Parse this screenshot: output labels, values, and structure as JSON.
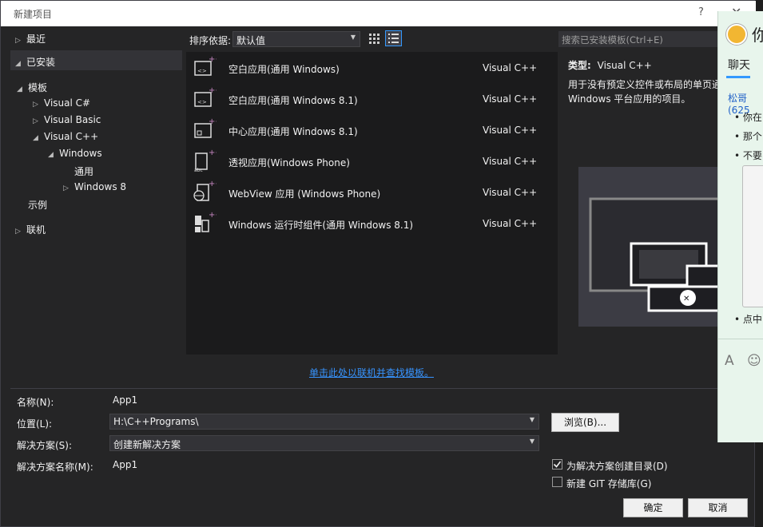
{
  "dialog": {
    "title": "新建项目",
    "help": "?",
    "close": "✕"
  },
  "tree": {
    "recent": "最近",
    "installed": "已安装",
    "templates": "模板",
    "csharp": "Visual C#",
    "vb": "Visual Basic",
    "cpp": "Visual C++",
    "windows": "Windows",
    "universal": "通用",
    "win8": "Windows 8",
    "samples": "示例",
    "online": "联机"
  },
  "sort": {
    "label": "排序依据:",
    "value": "默认值"
  },
  "search": {
    "placeholder": "搜索已安装模板(Ctrl+E)"
  },
  "templates": [
    {
      "name": "空白应用(通用 Windows)",
      "lang": "Visual C++"
    },
    {
      "name": "空白应用(通用 Windows 8.1)",
      "lang": "Visual C++"
    },
    {
      "name": "中心应用(通用 Windows 8.1)",
      "lang": "Visual C++"
    },
    {
      "name": "透视应用(Windows Phone)",
      "lang": "Visual C++"
    },
    {
      "name": "WebView 应用 (Windows Phone)",
      "lang": "Visual C++"
    },
    {
      "name": "Windows 运行时组件(通用 Windows 8.1)",
      "lang": "Visual C++"
    }
  ],
  "description": {
    "type_label": "类型:",
    "type_value": "Visual C++",
    "text": "用于没有预定义控件或布局的单页通 Windows 平台应用的项目。"
  },
  "online_link": "单击此处以联机并查找模板。",
  "form": {
    "name_label": "名称(N):",
    "name_value": "App1",
    "location_label": "位置(L):",
    "location_value": "H:\\C++Programs\\",
    "solution_label": "解决方案(S):",
    "solution_value": "创建新解决方案",
    "solution_name_label": "解决方案名称(M):",
    "solution_name_value": "App1",
    "browse": "浏览(B)...",
    "create_dir": "为解决方案创建目录(D)",
    "create_dir_checked": true,
    "git": "新建 GIT 存储库(G)",
    "git_checked": false,
    "ok": "确定",
    "cancel": "取消"
  },
  "chat": {
    "title_fragment": "你",
    "tab": "聊天",
    "sender": "松哥(625",
    "bullets": [
      "你在",
      "那个",
      "不要"
    ],
    "last_bullet": "点中",
    "icons": [
      "font-icon",
      "emoji-icon"
    ]
  },
  "colors": {
    "accent": "#3399ff",
    "link": "#3794ff",
    "template_icon_plus": "#c586c0"
  }
}
